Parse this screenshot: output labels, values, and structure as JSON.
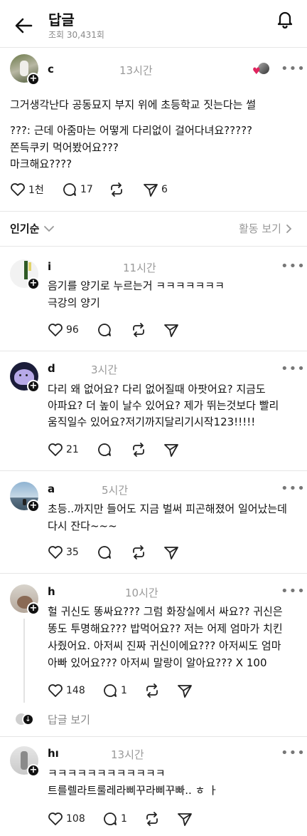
{
  "header": {
    "title": "답글",
    "views": "조회 30,431회"
  },
  "post": {
    "username": "c",
    "time": "13시간",
    "lines": [
      "그거생각난다 공동묘지 부지 위에 초등학교 짓는다는 썰",
      "???: 근데 아줌마는 어떻게 다리없이 걸어다녀요?????",
      "쫀득쿠키 먹어봤어요???",
      "마크해요????"
    ],
    "likes": "1천",
    "comments": "17",
    "shares": "6"
  },
  "sort": {
    "label": "인기순",
    "activity": "활동 보기"
  },
  "replies": [
    {
      "username": "i",
      "time": "11시간",
      "lines": [
        "음기를 양기로 누르는거 ㅋㅋㅋㅋㅋㅋㅋ",
        "극강의 양기"
      ],
      "likes": "96"
    },
    {
      "username": "d",
      "time": "3시간",
      "lines": [
        "다리 왜 없어요? 다리 없어질때 아팟어요? 지금도",
        "아파요?  더 높이 날수 있어요? 제가 뛰는것보다 빨리",
        "움직일수 있어요?저기까지달리기시작123!!!!!"
      ],
      "likes": "21"
    },
    {
      "username": "a",
      "time": "5시간",
      "lines": [
        "초등..까지만 들어도 지금 벌써 피곤해졌어 일어났는데",
        "다시 잔다~~~"
      ],
      "likes": "35"
    },
    {
      "username": "h",
      "time": "10시간",
      "lines": [
        "헐 귀신도 똥싸요??? 그럼 화장실에서 싸요?? 귀신은",
        "똥도 투명해요??? 밥먹어요?? 저는 어제 엄마가 치킨",
        "사줬어요. 아저씨 진짜 귀신이에요??? 아저씨도 엄마",
        "아빠 있어요??? 아저씨 말랑이 알아요??? X 100"
      ],
      "likes": "148",
      "comments": "1",
      "view_replies": "답글 보기"
    },
    {
      "username": "hı",
      "time": "13시간",
      "lines": [
        "ㅋㅋㅋㅋㅋㅋㅋㅋㅋㅋㅋㅋ",
        "트를렐라트룰레라삐꾸라삐꾸빠.. ㅎ ㅏ"
      ],
      "likes": "108",
      "comments": "1"
    }
  ]
}
